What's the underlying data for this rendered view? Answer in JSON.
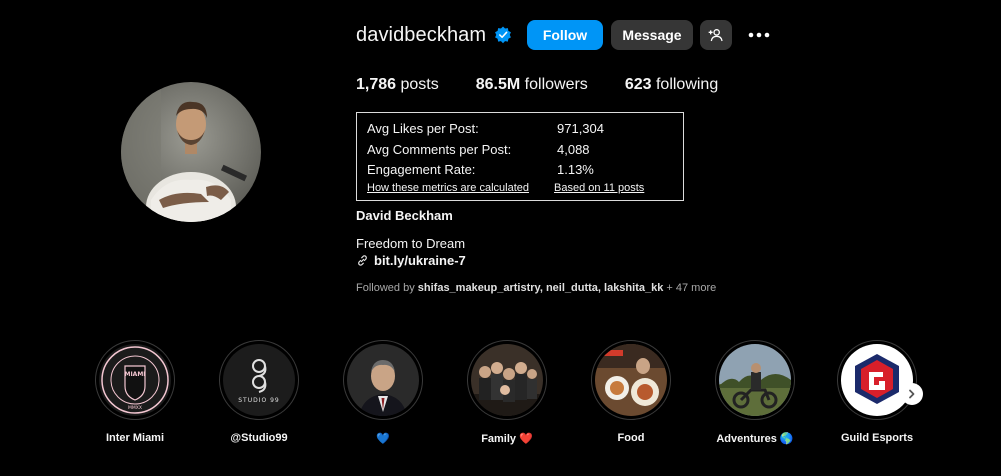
{
  "profile": {
    "username": "davidbeckham",
    "full_name": "David Beckham",
    "bio": "Freedom to Dream",
    "link": "bit.ly/ukraine-7",
    "followed_by_prefix": "Followed by",
    "followed_by_names": "shifas_makeup_artistry, neil_dutta, lakshita_kk",
    "followed_by_more": "+ 47 more"
  },
  "actions": {
    "follow": "Follow",
    "message": "Message"
  },
  "stats": {
    "posts_count": "1,786",
    "posts_label": "posts",
    "followers_count": "86.5M",
    "followers_label": "followers",
    "following_count": "623",
    "following_label": "following"
  },
  "metrics": {
    "likes_label": "Avg Likes per Post:",
    "likes_value": "971,304",
    "comments_label": "Avg Comments per Post:",
    "comments_value": "4,088",
    "engagement_label": "Engagement Rate:",
    "engagement_value": "1.13%",
    "how_link": "How these metrics are calculated",
    "based_link": "Based on 11 posts"
  },
  "highlights": [
    {
      "label": "Inter Miami"
    },
    {
      "label": "@Studio99"
    },
    {
      "label": "💙"
    },
    {
      "label": "Family ❤️"
    },
    {
      "label": "Food"
    },
    {
      "label": "Adventures 🌎"
    },
    {
      "label": "Guild Esports"
    }
  ],
  "highlight_image_texts": {
    "inter_miami_top": "MIAMI",
    "inter_miami_bottom": "MMXX",
    "studio99": "STUDIO 99"
  },
  "colors": {
    "accent": "#0095f6",
    "button_secondary": "#363636",
    "background": "#000000",
    "verified": "#0095f6"
  },
  "icons": [
    "verified-badge-icon",
    "add-user-icon",
    "more-options-icon",
    "link-icon",
    "chevron-right-icon"
  ]
}
